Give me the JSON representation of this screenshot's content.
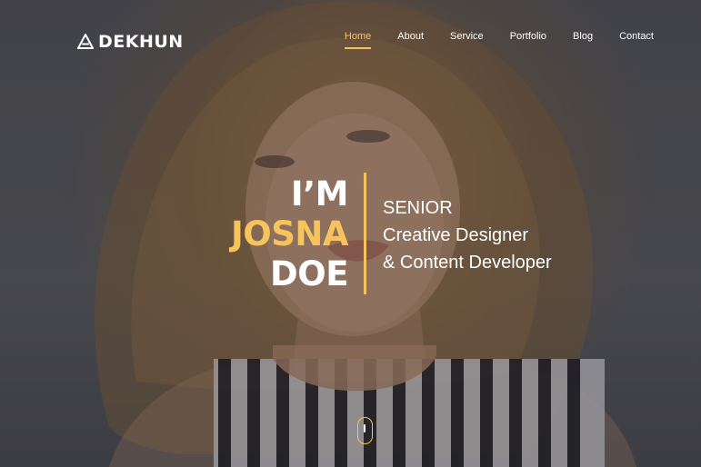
{
  "header": {
    "logo_text": "DEKHUN",
    "logo_icon": "triangle-logo-icon",
    "nav": [
      {
        "label": "Home",
        "active": true
      },
      {
        "label": "About",
        "active": false
      },
      {
        "label": "Service",
        "active": false
      },
      {
        "label": "Portfolio",
        "active": false
      },
      {
        "label": "Blog",
        "active": false
      },
      {
        "label": "Contact",
        "active": false
      }
    ]
  },
  "hero": {
    "name_lines": [
      "I’M",
      "JOSNA",
      "DOE"
    ],
    "role_lines": [
      "SENIOR",
      "Creative Designer",
      "& Content Developer"
    ],
    "scroll_icon": "mouse-scroll-icon"
  },
  "colors": {
    "accent": "#f7c35c",
    "text": "#ffffff",
    "overlay": "#1e1e23"
  }
}
